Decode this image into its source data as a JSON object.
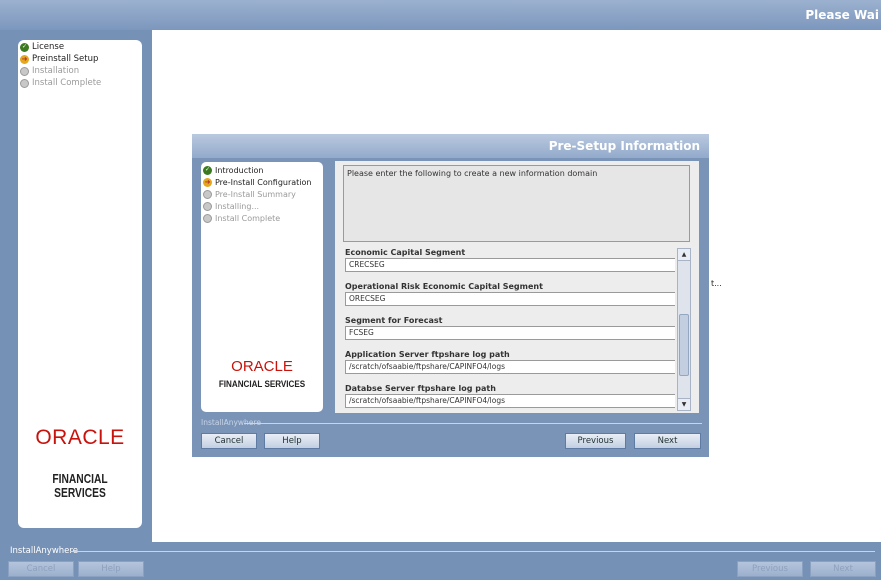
{
  "window": {
    "title": "Please Wai"
  },
  "outer_steps": [
    {
      "label": "License",
      "state": "done"
    },
    {
      "label": "Preinstall Setup",
      "state": "current"
    },
    {
      "label": "Installation",
      "state": "pending"
    },
    {
      "label": "Install Complete",
      "state": "pending"
    }
  ],
  "branding": {
    "oracle": "ORACLE",
    "financial_services": "FINANCIAL SERVICES"
  },
  "outer_footer": {
    "installanywhere_label": "InstallAnywhere",
    "cancel_label": "Cancel",
    "help_label": "Help",
    "previous_label": "Previous",
    "next_label": "Next"
  },
  "background_text": "t...",
  "dialog": {
    "title": "Pre-Setup Information",
    "steps": [
      {
        "label": "Introduction",
        "state": "done"
      },
      {
        "label": "Pre-Install Configuration",
        "state": "current"
      },
      {
        "label": "Pre-Install Summary",
        "state": "pending"
      },
      {
        "label": "Installing...",
        "state": "pending"
      },
      {
        "label": "Install Complete",
        "state": "pending"
      }
    ],
    "description": "Please enter the following to create a new information domain",
    "fields": [
      {
        "label": "Economic Capital Segment",
        "value": "CRECSEG"
      },
      {
        "label": "Operational Risk Economic Capital Segment",
        "value": "ORECSEG"
      },
      {
        "label": "Segment for Forecast",
        "value": "FCSEG"
      },
      {
        "label": "Application Server ftpshare log path",
        "value": "/scratch/ofsaabie/ftpshare/CAPINFO4/logs"
      },
      {
        "label": "Databse Server ftpshare log path",
        "value": "/scratch/ofsaabie/ftpshare/CAPINFO4/logs"
      }
    ],
    "footer": {
      "installanywhere_label": "InstallAnywhere",
      "cancel_label": "Cancel",
      "help_label": "Help",
      "previous_label": "Previous",
      "next_label": "Next"
    }
  },
  "colors": {
    "frame_blue": "#7691b6",
    "title_bar": "#8aa3c6",
    "oracle_red": "#c8120b",
    "done_green": "#3c7a22",
    "current_yellow": "#e3a81f"
  }
}
